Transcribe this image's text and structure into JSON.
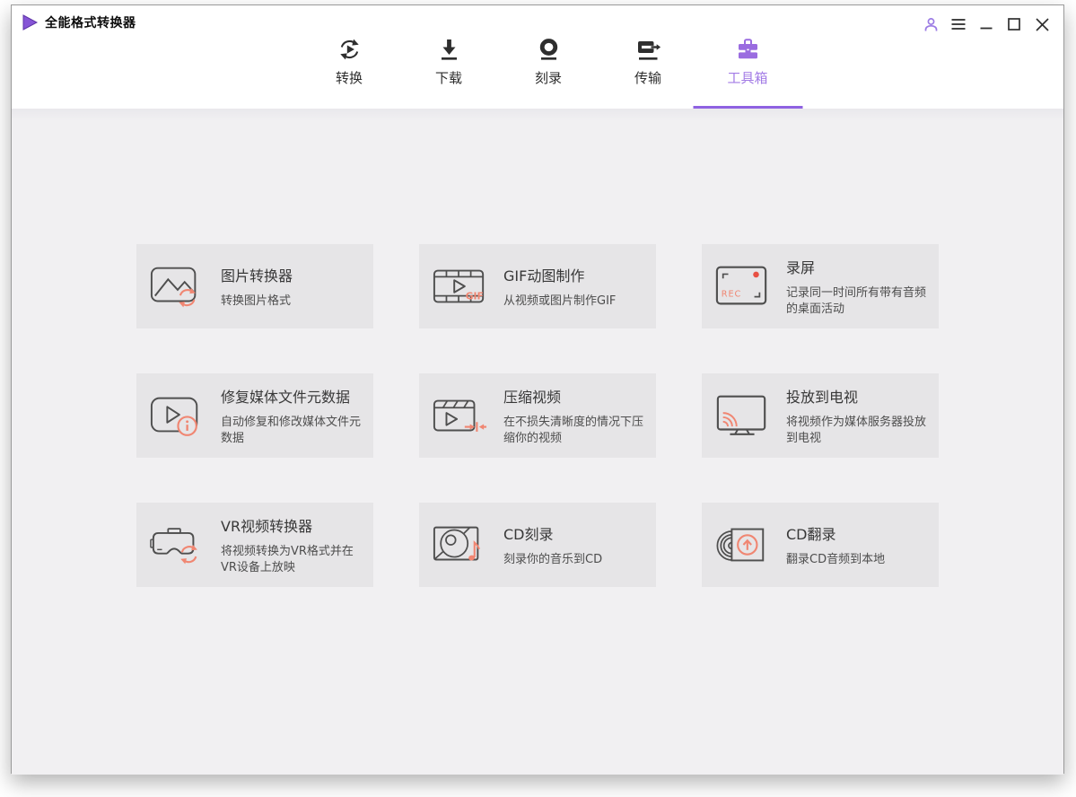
{
  "app": {
    "title": "全能格式转换器",
    "accent_color": "#9a6ce0",
    "icon_accent_color": "#f08672"
  },
  "titlebar": {
    "controls": [
      {
        "name": "account",
        "icon": "user-icon"
      },
      {
        "name": "menu",
        "icon": "hamburger-icon"
      },
      {
        "name": "minimize",
        "icon": "minimize-icon"
      },
      {
        "name": "maximize",
        "icon": "maximize-icon"
      },
      {
        "name": "close",
        "icon": "close-icon"
      }
    ]
  },
  "nav": {
    "tabs": [
      {
        "label": "转换",
        "icon": "convert-icon",
        "active": false
      },
      {
        "label": "下载",
        "icon": "download-icon",
        "active": false
      },
      {
        "label": "刻录",
        "icon": "burn-icon",
        "active": false
      },
      {
        "label": "传输",
        "icon": "transfer-icon",
        "active": false
      },
      {
        "label": "工具箱",
        "icon": "toolbox-icon",
        "active": true
      }
    ]
  },
  "toolbox": {
    "cards": [
      {
        "title": "图片转换器",
        "subtitle": "转换图片格式",
        "icon": "image-converter-icon"
      },
      {
        "title": "GIF动图制作",
        "subtitle": "从视频或图片制作GIF",
        "icon": "gif-maker-icon",
        "icon_text": "GIF"
      },
      {
        "title": "录屏",
        "subtitle": "记录同一时间所有带有音频的桌面活动",
        "icon": "screen-recorder-icon",
        "icon_text": "REC"
      },
      {
        "title": "修复媒体文件元数据",
        "subtitle": "自动修复和修改媒体文件元数据",
        "icon": "fix-metadata-icon"
      },
      {
        "title": "压缩视频",
        "subtitle": "在不损失清晰度的情况下压缩你的视频",
        "icon": "compress-video-icon"
      },
      {
        "title": "投放到电视",
        "subtitle": "将视频作为媒体服务器投放到电视",
        "icon": "cast-to-tv-icon"
      },
      {
        "title": "VR视频转换器",
        "subtitle": "将视频转换为VR格式并在VR设备上放映",
        "icon": "vr-converter-icon"
      },
      {
        "title": "CD刻录",
        "subtitle": "刻录你的音乐到CD",
        "icon": "cd-burn-icon"
      },
      {
        "title": "CD翻录",
        "subtitle": "翻录CD音频到本地",
        "icon": "cd-rip-icon"
      }
    ]
  }
}
